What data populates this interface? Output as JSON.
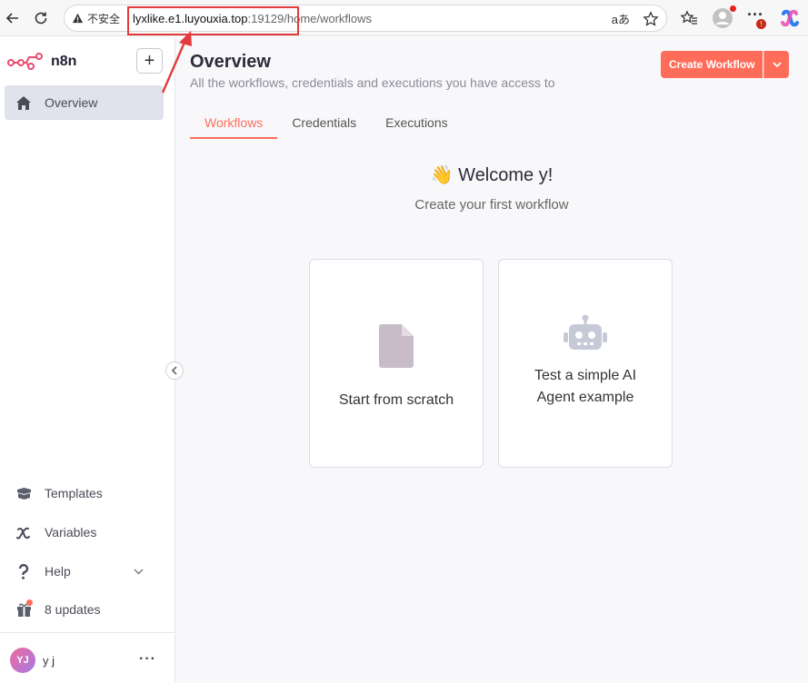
{
  "browser": {
    "insecure_label": "不安全",
    "url_host": "lyxlike.e1.luyouxia.top",
    "url_rest": ":19129/home/workflows",
    "translate_label": "aあ"
  },
  "sidebar": {
    "logo_text": "n8n",
    "items": [
      {
        "label": "Overview"
      },
      {
        "label": "Templates"
      },
      {
        "label": "Variables"
      },
      {
        "label": "Help"
      },
      {
        "label": "8 updates"
      }
    ],
    "user": {
      "initials": "YJ",
      "name": "y j"
    }
  },
  "main": {
    "title": "Overview",
    "subtitle": "All the workflows, credentials and executions you have access to",
    "create_button": "Create Workflow",
    "tabs": [
      {
        "label": "Workflows",
        "active": true
      },
      {
        "label": "Credentials",
        "active": false
      },
      {
        "label": "Executions",
        "active": false
      }
    ],
    "welcome_emoji": "👋",
    "welcome": "Welcome y!",
    "welcome_sub": "Create your first workflow",
    "cards": [
      {
        "label": "Start from scratch",
        "icon": "file-icon"
      },
      {
        "label": "Test a simple AI Agent example",
        "icon": "robot-icon"
      }
    ]
  },
  "colors": {
    "accent": "#ff6d5a",
    "annotation": "#e23b3b"
  }
}
